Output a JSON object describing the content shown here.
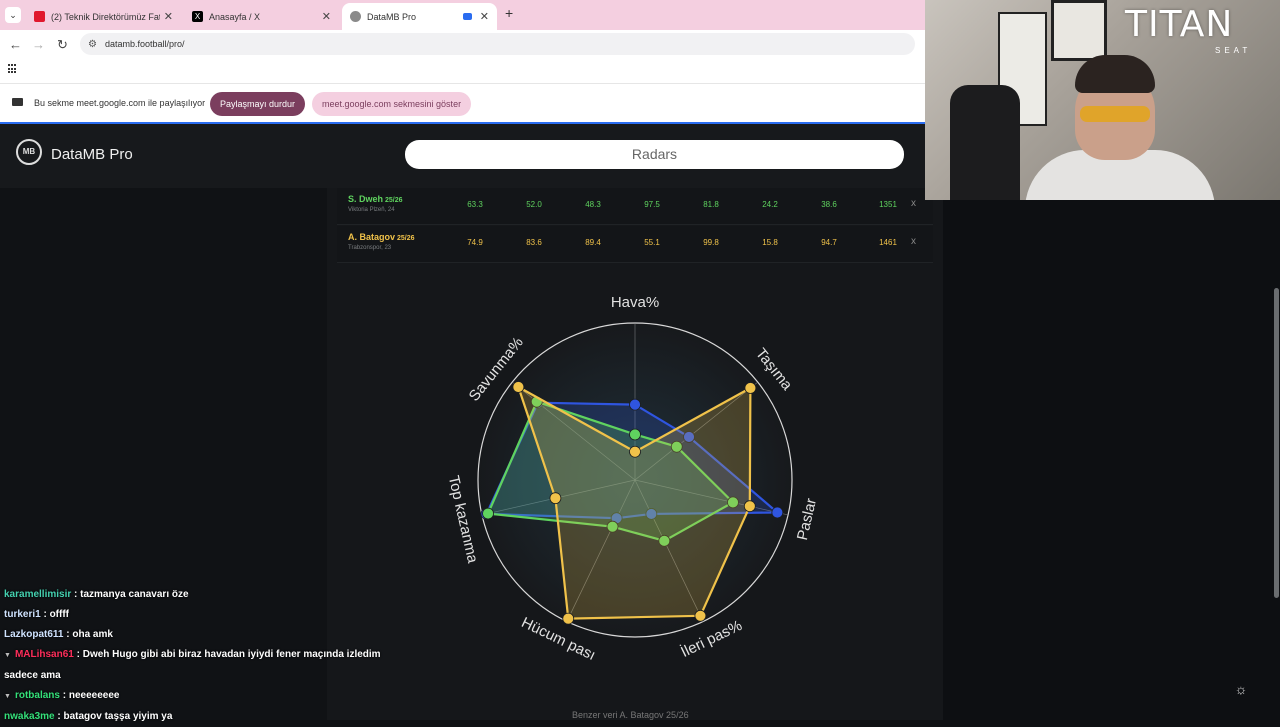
{
  "browser": {
    "tabs": [
      {
        "title": "(2) Teknik Direktörümüz Fatih T",
        "favicon_color": "#e0182d"
      },
      {
        "title": "Anasayfa / X",
        "favicon_color": "#000000"
      },
      {
        "title": "DataMB Pro",
        "favicon_color": "#8a8a8a"
      }
    ],
    "url": "datamb.football/pro/",
    "share_bar": {
      "message": "Bu sekme meet.google.com ile paylaşılıyor",
      "stop_label": "Paylaşmayı durdur",
      "show_label": "meet.google.com sekmesini göster"
    }
  },
  "app": {
    "brand": "DataMB Pro",
    "logo_text": "MB",
    "page_button": "Radars",
    "players": [
      {
        "name": "S. Dweh",
        "season": "25/26",
        "club": "Viktoria Plzeň, 24",
        "color": "#5fd35f",
        "stats": [
          "63.3",
          "52.0",
          "48.3",
          "97.5",
          "81.8",
          "24.2",
          "38.6",
          "1351"
        ]
      },
      {
        "name": "A. Batagov",
        "season": "25/26",
        "club": "Trabzonspor, 23",
        "color": "#f0c24a",
        "stats": [
          "74.9",
          "83.6",
          "89.4",
          "55.1",
          "99.8",
          "15.8",
          "94.7",
          "1461"
        ]
      }
    ],
    "remove_label": "x",
    "similar_text": "Benzer veri A. Batagov 25/26"
  },
  "chart_data": {
    "type": "radar",
    "axes": [
      "Hava%",
      "Taşıma",
      "Paslar",
      "İleri pas%",
      "Hücum pası",
      "Top kazanma",
      "Savunma%"
    ],
    "range": [
      0,
      100
    ],
    "grid": true,
    "series": [
      {
        "name": "",
        "color": "#2f55e0",
        "values": [
          48,
          44,
          93,
          24,
          27,
          97,
          79
        ]
      },
      {
        "name": "S. Dweh",
        "color": "#5fd35f",
        "values": [
          29,
          34,
          64,
          43,
          33,
          96,
          80
        ]
      },
      {
        "name": "A. Batagov",
        "color": "#f0c24a",
        "values": [
          18,
          94,
          75,
          96,
          98,
          52,
          95
        ]
      }
    ]
  },
  "chat": [
    {
      "user": "karamellimisir",
      "color": "#44d1b0",
      "text": "tazmanya canavarı öze",
      "collapsed": false
    },
    {
      "user": "turkeri1",
      "color": "#cfe3ff",
      "text": "offff",
      "collapsed": false
    },
    {
      "user": "Lazkopat611",
      "color": "#cfe3ff",
      "text": "oha amk",
      "collapsed": false
    },
    {
      "user": "MALihsan61",
      "color": "#ff2e5b",
      "text": "Dweh Hugo gibi abi biraz havadan iyiydi fener maçında izledim sadece ama",
      "collapsed": true
    },
    {
      "user": "rotbalans",
      "color": "#34e07a",
      "text": "neeeeeeee",
      "collapsed": true
    },
    {
      "user": "nwaka3me",
      "color": "#34e07a",
      "text": "batagov taşşa yiyim ya",
      "collapsed": false
    }
  ],
  "webcam": {
    "logo": "TITAN",
    "logo_sub": "SEAT"
  }
}
